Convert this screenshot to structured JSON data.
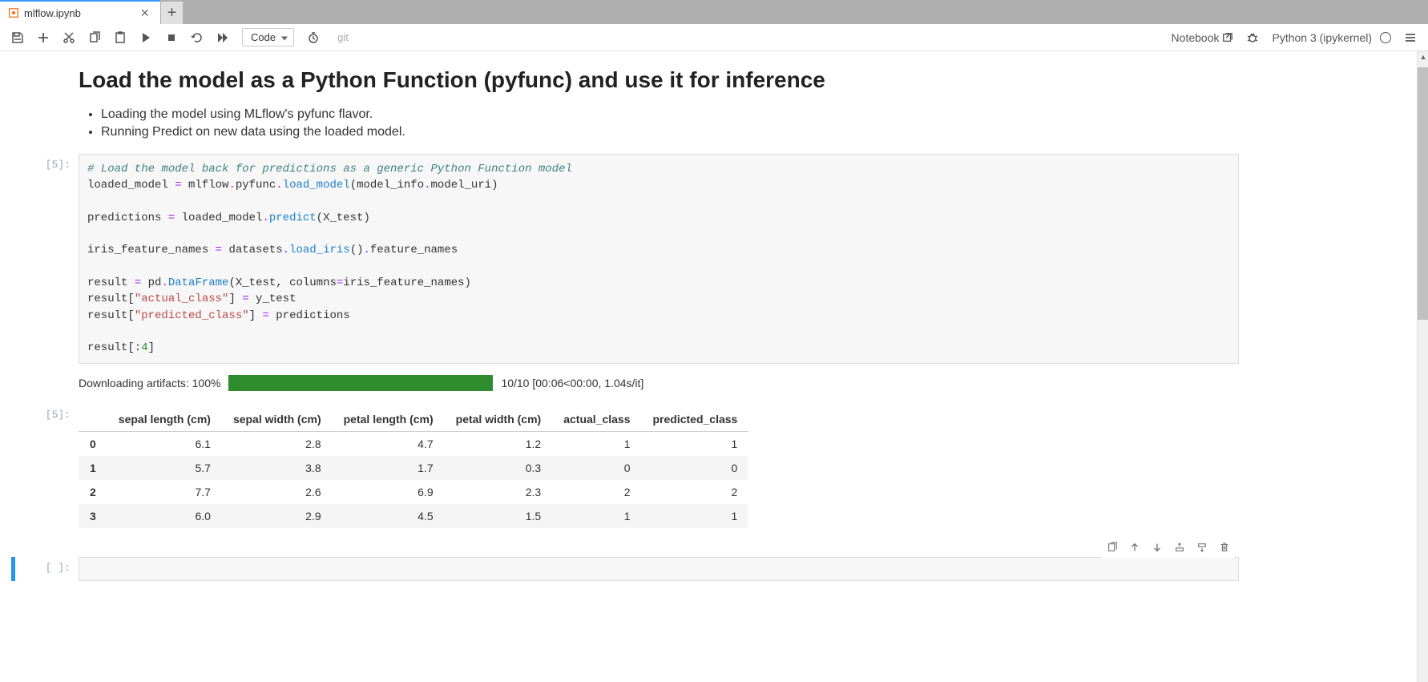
{
  "tab": {
    "title": "mlflow.ipynb"
  },
  "toolbar": {
    "cell_type": "Code",
    "git_label": "git",
    "notebook_label": "Notebook",
    "kernel_label": "Python 3 (ipykernel)"
  },
  "markdown": {
    "heading": "Load the model as a Python Function (pyfunc) and use it for inference",
    "bullets": [
      "Loading the model using MLflow's pyfunc flavor.",
      "Running Predict on new data using the loaded model."
    ]
  },
  "code_cell": {
    "prompt": "[5]:",
    "lines": {
      "c1": "# Load the model back for predictions as a generic Python Function model",
      "l2_a": "loaded_model ",
      "l2_op": "=",
      "l2_b": " mlflow",
      "l2_c": ".",
      "l2_d": "pyfunc",
      "l2_e": ".",
      "l2_f": "load_model",
      "l2_g": "(model_info",
      "l2_h": ".",
      "l2_i": "model_uri",
      "l2_j": ")",
      "l3_a": "predictions ",
      "l3_op": "=",
      "l3_b": " loaded_model",
      "l3_c": ".",
      "l3_d": "predict",
      "l3_e": "(X_test)",
      "l4_a": "iris_feature_names ",
      "l4_op": "=",
      "l4_b": " datasets",
      "l4_c": ".",
      "l4_d": "load_iris",
      "l4_e": "()",
      "l4_f": ".",
      "l4_g": "feature_names",
      "l5_a": "result ",
      "l5_op": "=",
      "l5_b": " pd",
      "l5_c": ".",
      "l5_d": "DataFrame",
      "l5_e": "(X_test, columns",
      "l5_eq": "=",
      "l5_f": "iris_feature_names)",
      "l6_a": "result[",
      "l6_s": "\"actual_class\"",
      "l6_b": "] ",
      "l6_op": "=",
      "l6_c": " y_test",
      "l7_a": "result[",
      "l7_s": "\"predicted_class\"",
      "l7_b": "] ",
      "l7_op": "=",
      "l7_c": " predictions",
      "l8_a": "result[:",
      "l8_n": "4",
      "l8_b": "]"
    }
  },
  "output": {
    "prompt": "[5]:",
    "progress_label": "Downloading artifacts: 100%",
    "progress_pct": 100,
    "progress_stats": "10/10 [00:06<00:00,  1.04s/it]",
    "table": {
      "columns": [
        "",
        "sepal length (cm)",
        "sepal width (cm)",
        "petal length (cm)",
        "petal width (cm)",
        "actual_class",
        "predicted_class"
      ],
      "rows": [
        [
          "0",
          "6.1",
          "2.8",
          "4.7",
          "1.2",
          "1",
          "1"
        ],
        [
          "1",
          "5.7",
          "3.8",
          "1.7",
          "0.3",
          "0",
          "0"
        ],
        [
          "2",
          "7.7",
          "2.6",
          "6.9",
          "2.3",
          "2",
          "2"
        ],
        [
          "3",
          "6.0",
          "2.9",
          "4.5",
          "1.5",
          "1",
          "1"
        ]
      ]
    }
  },
  "empty_cell": {
    "prompt": "[ ]:"
  }
}
